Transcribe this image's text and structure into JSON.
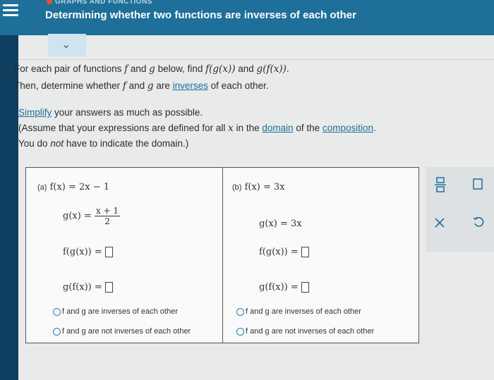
{
  "header": {
    "section_label": "GRAPHS AND FUNCTIONS",
    "title": "Determining whether two functions are inverses of each other"
  },
  "instructions": {
    "line1_a": "For each pair of functions",
    "line1_b": "and",
    "line1_c": "below, find",
    "line1_d": "and",
    "line2_a": "Then, determine whether",
    "line2_b": "and",
    "line2_c": "are",
    "line2_link": "inverses",
    "line2_d": "of each other.",
    "simplify_link": "Simplify",
    "simplify_rest": "your answers as much as possible.",
    "assume_a": "(Assume that your expressions are defined for all",
    "assume_b": "in the",
    "domain_link": "domain",
    "assume_c": "of the",
    "composition_link": "composition",
    "assume_d": ".",
    "donot_a": "You do",
    "donot_b": "not",
    "donot_c": "have to indicate the domain.)"
  },
  "math": {
    "f": "f",
    "g": "g",
    "x": "x",
    "fgx": "f(g(x))",
    "gfx": "g(f(x))"
  },
  "part_a": {
    "label": "(a)",
    "f_def": "f(x) = 2x − 1",
    "g_lhs": "g(x) =",
    "g_num": "x + 1",
    "g_den": "2",
    "fg_lhs": "f(g(x)) =",
    "gf_lhs": "g(f(x)) =",
    "option_inverse": "f and g are inverses of each other",
    "option_not_inverse": "f and g are not inverses of each other"
  },
  "part_b": {
    "label": "(b)",
    "f_def": "f(x) = 3x",
    "g_def": "g(x) = 3x",
    "fg_lhs": "f(g(x)) =",
    "gf_lhs": "g(f(x)) =",
    "option_inverse": "f and g are inverses of each other",
    "option_not_inverse": "f and g are not inverses of each other"
  },
  "icons": {
    "fraction": "fraction-icon",
    "clear": "x-icon",
    "undo": "undo-icon"
  }
}
